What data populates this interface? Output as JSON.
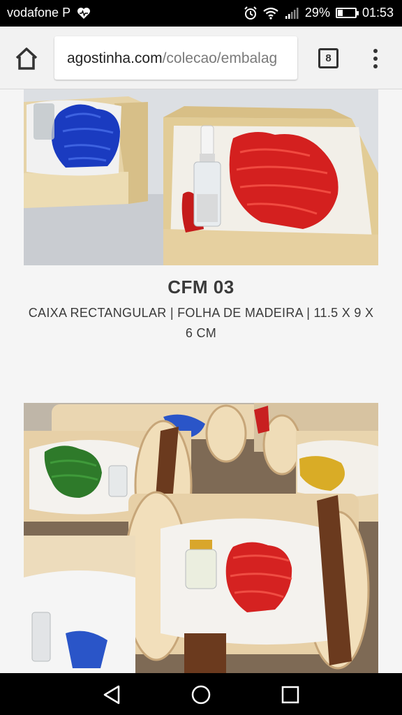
{
  "status_bar": {
    "carrier": "vodafone P",
    "battery_percent": "29%",
    "battery_level": 0.29,
    "time": "01:53"
  },
  "browser": {
    "url_host": "agostinha.com",
    "url_path": "/colecao/embalag",
    "tab_count": "8"
  },
  "product": {
    "title": "CFM 03",
    "description": "CAIXA RECTANGULAR | FOLHA DE MADEIRA | 11.5 X 9 X 6 CM"
  },
  "colors": {
    "status_bg": "#000000",
    "toolbar_bg": "#f2f2f2",
    "page_bg": "#f5f5f5",
    "text": "#3a3a3a"
  }
}
